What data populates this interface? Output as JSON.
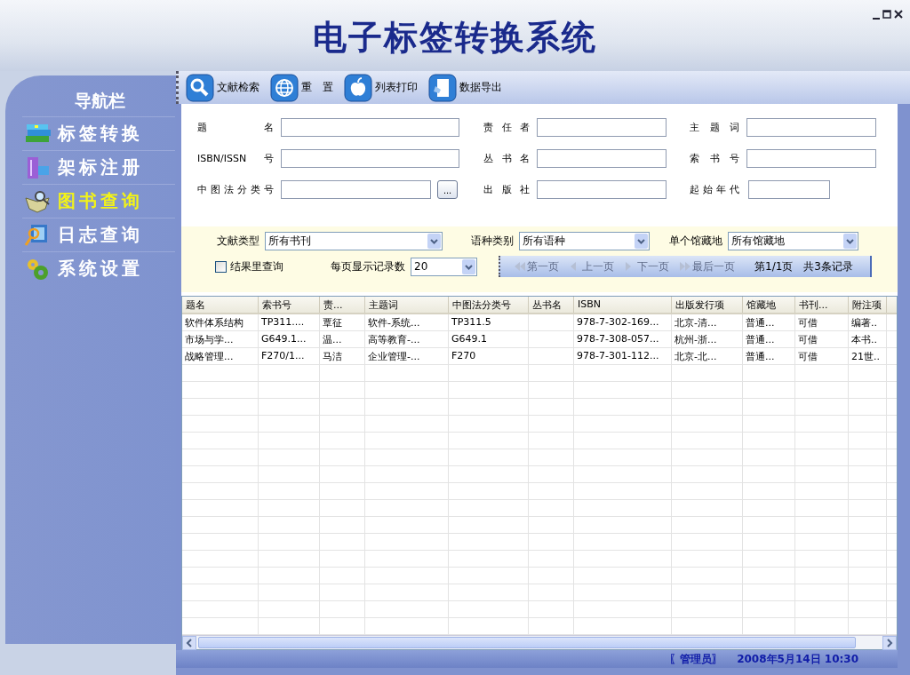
{
  "window": {
    "title": "电子标签转换系统"
  },
  "sidebar": {
    "title": "导航栏",
    "items": [
      {
        "label": "标签转换",
        "selected": false
      },
      {
        "label": "架标注册",
        "selected": false
      },
      {
        "label": "图书查询",
        "selected": true
      },
      {
        "label": "日志查询",
        "selected": false
      },
      {
        "label": "系统设置",
        "selected": false
      }
    ]
  },
  "toolbar": [
    {
      "label": "文献检索"
    },
    {
      "label": "重　置"
    },
    {
      "label": "列表打印"
    },
    {
      "label": "数据导出"
    }
  ],
  "search_form": [
    {
      "label": "题名"
    },
    {
      "label": "责任者"
    },
    {
      "label": "主题词"
    },
    {
      "label": "ISBN/ISSN号"
    },
    {
      "label": "丛书名"
    },
    {
      "label": "索书号"
    },
    {
      "label": "中图法分类号",
      "browse_button": "..."
    },
    {
      "label": "出版社"
    },
    {
      "label": "起始年代"
    }
  ],
  "filters": [
    {
      "label": "文献类型",
      "value": "所有书刊"
    },
    {
      "label": "语种类别",
      "value": "所有语种"
    },
    {
      "label": "单个馆藏地",
      "value": "所有馆藏地"
    }
  ],
  "search_in_results": {
    "label": "结果里查询",
    "checked": false
  },
  "page_size": {
    "label": "每页显示记录数",
    "value": "20"
  },
  "pager": {
    "buttons": [
      {
        "label": "第一页",
        "disabled": true
      },
      {
        "label": "上一页",
        "disabled": true
      },
      {
        "label": "下一页",
        "disabled": true
      },
      {
        "label": "最后一页",
        "disabled": true
      }
    ],
    "page": "第1/1页",
    "total": "共3条记录"
  },
  "table": {
    "columns": [
      "题名",
      "索书号",
      "责...",
      "主题词",
      "中图法分类号",
      "丛书名",
      "ISBN",
      "出版发行项",
      "馆藏地",
      "书刊...",
      "附注项"
    ],
    "rows": [
      [
        "软件体系结构",
        "TP311....",
        "覃征",
        "软件-系统...",
        "TP311.5",
        null,
        "978-7-302-169...",
        "北京-清...",
        "普通...",
        "可借",
        "编著.."
      ],
      [
        "市场与学...",
        "G649.1...",
        "温...",
        "高等教育-...",
        "G649.1",
        null,
        "978-7-308-057...",
        "杭州-浙...",
        "普通...",
        "可借",
        "本书.."
      ],
      [
        "战略管理...",
        "F270/1...",
        "马洁",
        "企业管理-...",
        "F270",
        null,
        "978-7-301-112...",
        "北京-北...",
        "普通...",
        "可借",
        "21世.."
      ]
    ]
  },
  "status_bar": {
    "user": "〖管理员〗",
    "datetime": "2008年5月14日 10:30"
  }
}
